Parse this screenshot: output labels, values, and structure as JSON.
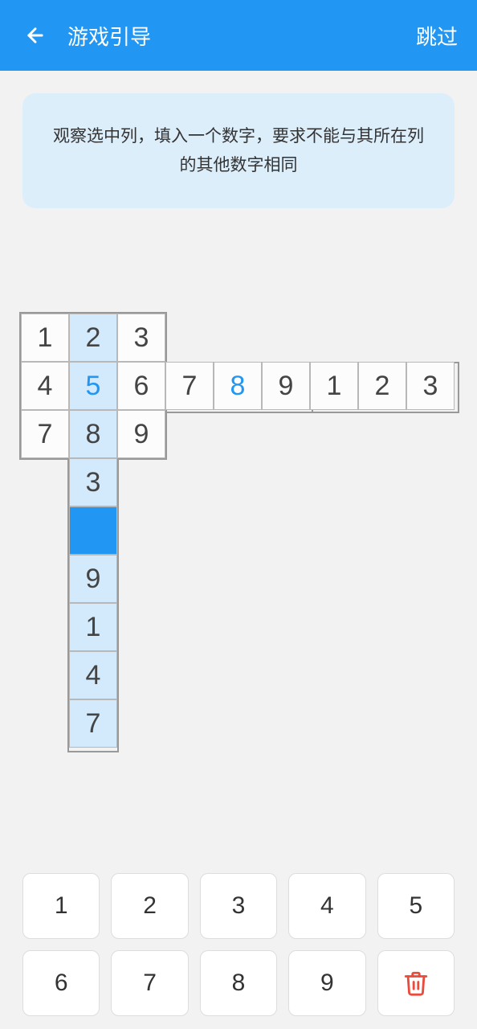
{
  "header": {
    "title": "游戏引导",
    "skip": "跳过"
  },
  "hint": "观察选中列，填入一个数字，要求不能与其所在列的其他数字相同",
  "cells": [
    {
      "r": 0,
      "c": 0,
      "v": "1",
      "hl": false
    },
    {
      "r": 0,
      "c": 1,
      "v": "2",
      "hl": true
    },
    {
      "r": 0,
      "c": 2,
      "v": "3",
      "hl": false
    },
    {
      "r": 1,
      "c": 0,
      "v": "4",
      "hl": false
    },
    {
      "r": 1,
      "c": 1,
      "v": "5",
      "hl": true,
      "blue": true
    },
    {
      "r": 1,
      "c": 2,
      "v": "6",
      "hl": false
    },
    {
      "r": 1,
      "c": 3,
      "v": "7",
      "hl": false
    },
    {
      "r": 1,
      "c": 4,
      "v": "8",
      "hl": false,
      "blue": true
    },
    {
      "r": 1,
      "c": 5,
      "v": "9",
      "hl": false
    },
    {
      "r": 1,
      "c": 6,
      "v": "1",
      "hl": false
    },
    {
      "r": 1,
      "c": 7,
      "v": "2",
      "hl": false
    },
    {
      "r": 1,
      "c": 8,
      "v": "3",
      "hl": false
    },
    {
      "r": 2,
      "c": 0,
      "v": "7",
      "hl": false
    },
    {
      "r": 2,
      "c": 1,
      "v": "8",
      "hl": true
    },
    {
      "r": 2,
      "c": 2,
      "v": "9",
      "hl": false
    },
    {
      "r": 3,
      "c": 1,
      "v": "3",
      "hl": true
    },
    {
      "r": 4,
      "c": 1,
      "v": "",
      "hl": true,
      "selected": true
    },
    {
      "r": 5,
      "c": 1,
      "v": "9",
      "hl": true
    },
    {
      "r": 6,
      "c": 1,
      "v": "1",
      "hl": true
    },
    {
      "r": 7,
      "c": 1,
      "v": "4",
      "hl": true
    },
    {
      "r": 8,
      "c": 1,
      "v": "7",
      "hl": true
    }
  ],
  "keys": [
    "1",
    "2",
    "3",
    "4",
    "5",
    "6",
    "7",
    "8",
    "9"
  ]
}
